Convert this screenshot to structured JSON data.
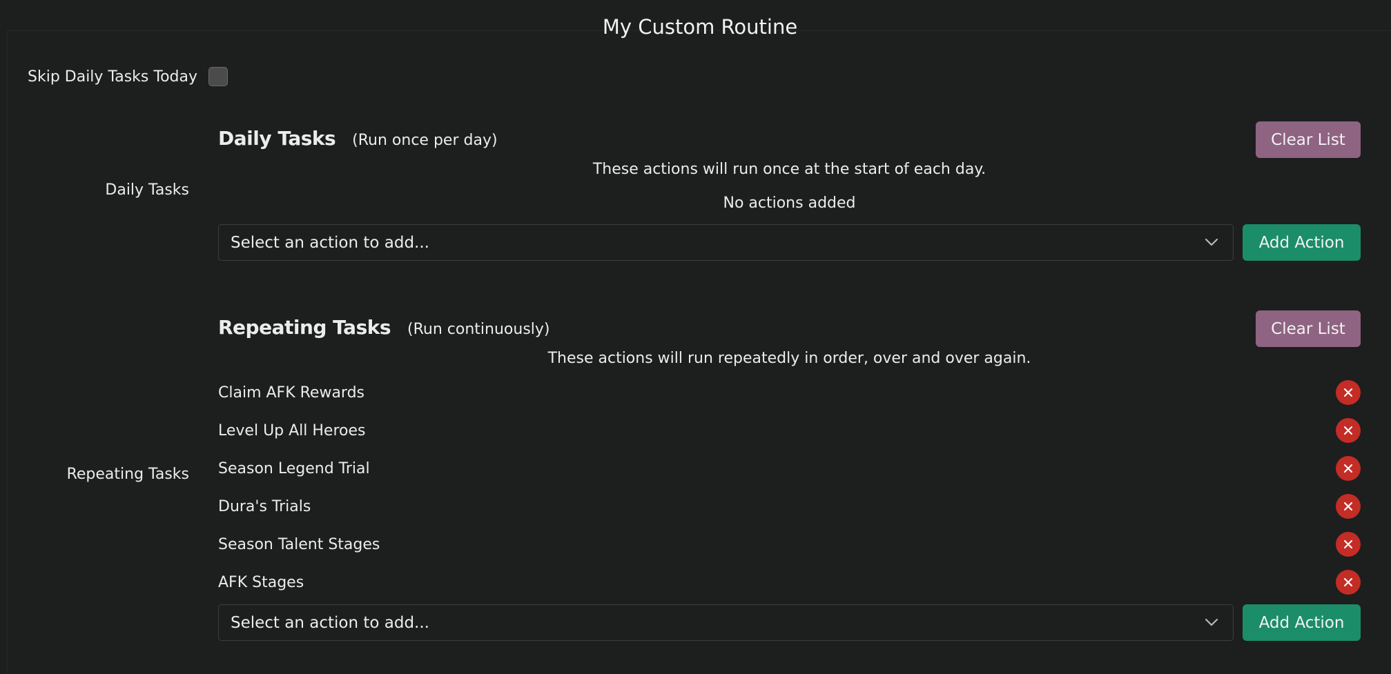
{
  "title": "My Custom Routine",
  "skip": {
    "label": "Skip Daily Tasks Today",
    "checked": false
  },
  "daily": {
    "side_label": "Daily Tasks",
    "heading": "Daily Tasks",
    "subheading": "(Run once per day)",
    "clear_label": "Clear List",
    "description": "These actions will run once at the start of each day.",
    "empty_text": "No actions added",
    "select_placeholder": "Select an action to add...",
    "add_label": "Add Action"
  },
  "repeating": {
    "side_label": "Repeating Tasks",
    "heading": "Repeating Tasks",
    "subheading": "(Run continuously)",
    "clear_label": "Clear List",
    "description": "These actions will run repeatedly in order, over and over again.",
    "items": [
      {
        "label": "Claim AFK Rewards"
      },
      {
        "label": "Level Up All Heroes"
      },
      {
        "label": "Season Legend Trial"
      },
      {
        "label": "Dura's Trials"
      },
      {
        "label": "Season Talent Stages"
      },
      {
        "label": "AFK Stages"
      }
    ],
    "select_placeholder": "Select an action to add...",
    "add_label": "Add Action"
  },
  "icons": {
    "remove": "close-icon",
    "dropdown": "chevron-down-icon"
  },
  "colors": {
    "clear_button": "#8f6382",
    "add_button": "#1b8d68",
    "remove_button": "#c42c26",
    "background": "#1d1e1e"
  }
}
